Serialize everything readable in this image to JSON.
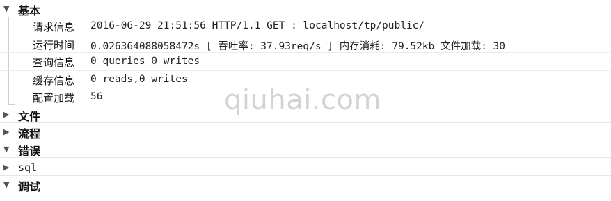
{
  "sections": {
    "basic": {
      "icon": "caret-down-icon",
      "title": "基本"
    },
    "file": {
      "icon": "caret-right-icon",
      "title": "文件"
    },
    "flow": {
      "icon": "caret-right-icon",
      "title": "流程"
    },
    "error": {
      "icon": "caret-down-icon",
      "title": "错误"
    },
    "sql": {
      "icon": "caret-right-icon",
      "title": "sql"
    },
    "debug": {
      "icon": "caret-down-icon",
      "title": "调试"
    }
  },
  "basic_entries": [
    {
      "key": "请求信息",
      "value": "2016-06-29 21:51:56 HTTP/1.1 GET : localhost/tp/public/"
    },
    {
      "key": "运行时间",
      "value": "0.026364088058472s [ 吞吐率: 37.93req/s ] 内存消耗: 79.52kb 文件加载: 30"
    },
    {
      "key": "查询信息",
      "value": "0 queries 0 writes"
    },
    {
      "key": "缓存信息",
      "value": "0 reads,0 writes"
    },
    {
      "key": "配置加载",
      "value": "56"
    }
  ],
  "watermark": "qiuhai.com"
}
